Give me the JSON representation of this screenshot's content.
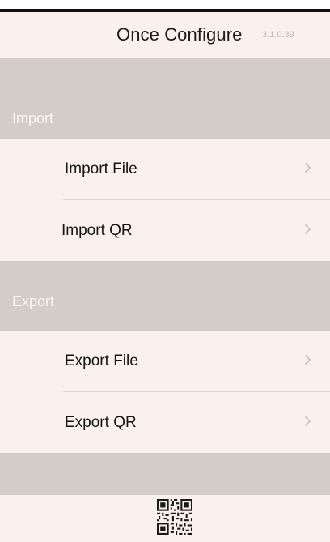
{
  "header": {
    "title": "Once Configure",
    "version": "3.1.0.39"
  },
  "sections": [
    {
      "label": "Import",
      "items": [
        {
          "label": "Import File",
          "icon": "chevron-right-icon"
        },
        {
          "label": "Import QR",
          "icon": "chevron-right-icon"
        }
      ]
    },
    {
      "label": "Export",
      "items": [
        {
          "label": "Export File",
          "icon": "chevron-right-icon"
        },
        {
          "label": "Export QR",
          "icon": "chevron-right-icon"
        }
      ]
    }
  ],
  "footer": {
    "icon": "qr-code-icon"
  },
  "colors": {
    "background": "#fbf1ec",
    "section_band": "#d4ccc6",
    "text": "#151515",
    "muted": "#b8b8b8"
  }
}
